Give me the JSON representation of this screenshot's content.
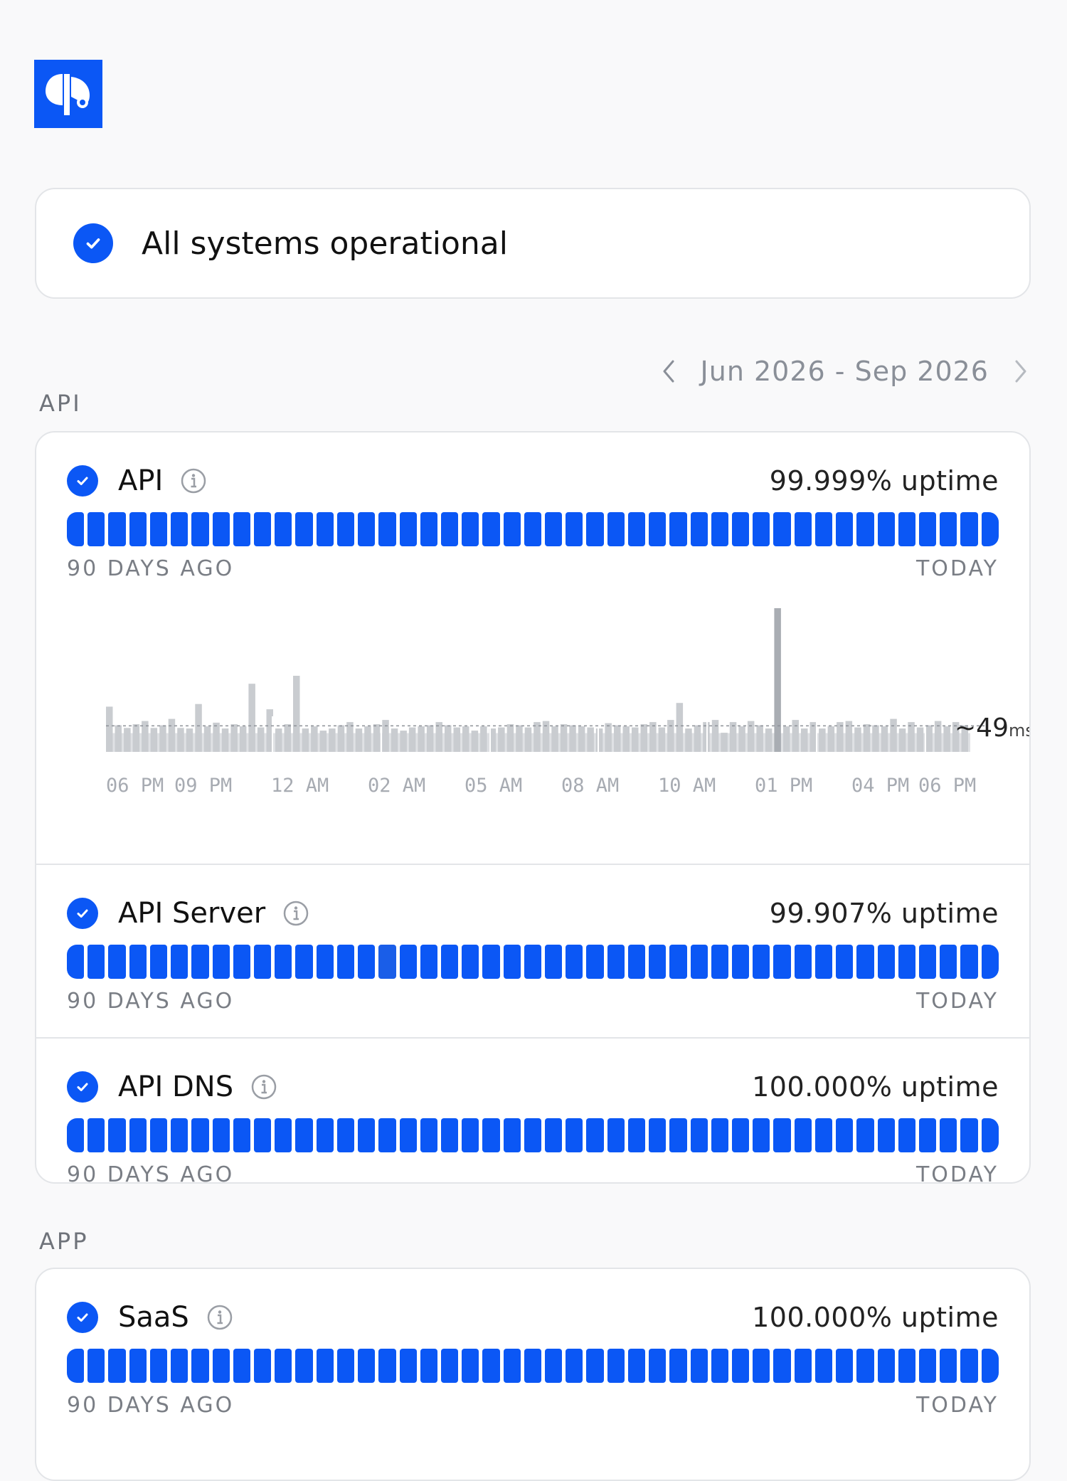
{
  "header": {
    "logo_icon": "brand-logo-icon"
  },
  "status_banner": {
    "text": "All systems operational",
    "icon": "check-circle-icon"
  },
  "date_range": {
    "label": "Jun 2026 - Sep 2026",
    "prev_icon": "chevron-left-icon",
    "next_icon": "chevron-right-icon"
  },
  "groups": [
    {
      "label": "API",
      "components": [
        {
          "name": "API",
          "uptime": "99.999% uptime",
          "start_label": "90 DAYS AGO",
          "end_label": "TODAY"
        },
        {
          "name": "API Server",
          "uptime": "99.907% uptime",
          "start_label": "90 DAYS AGO",
          "end_label": "TODAY"
        },
        {
          "name": "API DNS",
          "uptime": "100.000% uptime",
          "start_label": "90 DAYS AGO",
          "end_label": "TODAY"
        }
      ]
    },
    {
      "label": "APP",
      "components": [
        {
          "name": "SaaS",
          "uptime": "100.000% uptime",
          "start_label": "90 DAYS AGO",
          "end_label": "TODAY"
        }
      ]
    }
  ],
  "latency": {
    "current": "~49",
    "unit": "ms",
    "hour_labels": [
      "06 PM",
      "09 PM",
      "12 AM",
      "02 AM",
      "05 AM",
      "08 AM",
      "10 AM",
      "01 PM",
      "04 PM",
      "06 PM"
    ]
  },
  "colors": {
    "operational": "#0b57f5",
    "latency_bar": "#c9ccd0",
    "latency_spike": "#a9adb3"
  },
  "chart_data": {
    "type": "bar",
    "title": "",
    "xlabel": "",
    "ylabel": "",
    "x_tick_labels": [
      "06 PM",
      "09 PM",
      "12 AM",
      "02 AM",
      "05 AM",
      "08 AM",
      "10 AM",
      "01 PM",
      "04 PM",
      "06 PM"
    ],
    "reference_value": 49,
    "ylim": [
      0,
      270
    ],
    "values": [
      85,
      50,
      45,
      52,
      58,
      45,
      50,
      62,
      45,
      44,
      90,
      48,
      55,
      44,
      52,
      48,
      128,
      46,
      80,
      44,
      52,
      143,
      44,
      48,
      40,
      44,
      50,
      56,
      44,
      48,
      52,
      60,
      44,
      40,
      46,
      48,
      50,
      56,
      50,
      46,
      48,
      40,
      48,
      44,
      46,
      52,
      50,
      46,
      56,
      58,
      48,
      52,
      50,
      48,
      46,
      44,
      54,
      50,
      48,
      46,
      52,
      56,
      46,
      60,
      92,
      44,
      50,
      56,
      60,
      36,
      56,
      48,
      58,
      50,
      44,
      270,
      48,
      60,
      44,
      56,
      44,
      48,
      56,
      58,
      46,
      52,
      50,
      48,
      62,
      44,
      56,
      46,
      50,
      58,
      48,
      56,
      50
    ]
  }
}
